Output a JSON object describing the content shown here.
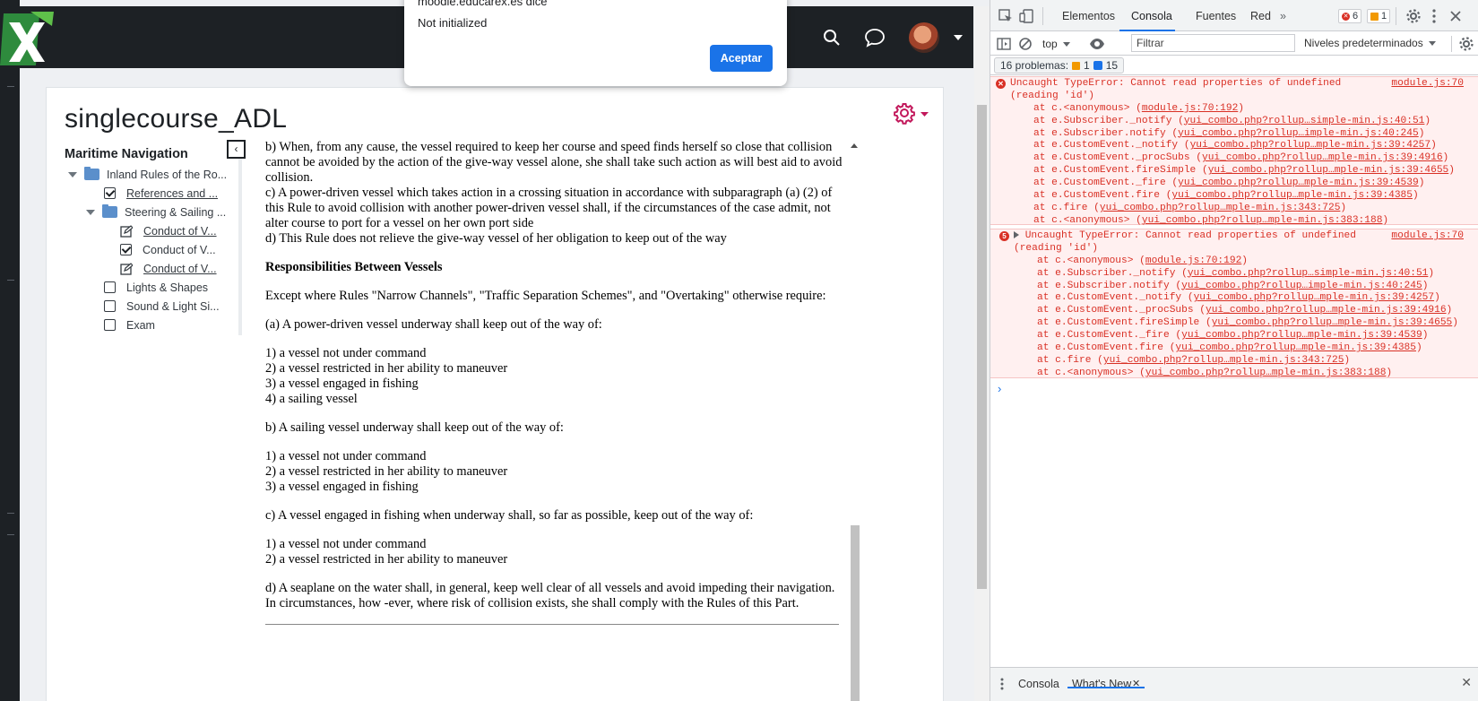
{
  "alert": {
    "title": "moodle.educarex.es dice",
    "message": "Not initialized",
    "ok_label": "Aceptar"
  },
  "course": {
    "title": "singlecourse_ADL"
  },
  "course_index": {
    "title": "Maritime Navigation",
    "items": [
      {
        "label": "Inland Rules of the Ro...",
        "kind": "section"
      },
      {
        "label": "References and ...",
        "kind": "done"
      },
      {
        "label": "Steering & Sailing ...",
        "kind": "section"
      },
      {
        "label": "Conduct of V...",
        "kind": "edit"
      },
      {
        "label": "Conduct of V...",
        "kind": "done"
      },
      {
        "label": "Conduct of V...",
        "kind": "edit"
      },
      {
        "label": "Lights & Shapes",
        "kind": "todo"
      },
      {
        "label": "Sound & Light Si...",
        "kind": "todo"
      },
      {
        "label": "Exam",
        "kind": "todo"
      }
    ]
  },
  "content": {
    "para_b": "b) When, from any cause, the vessel required to keep her course and speed finds herself so close that collision cannot be avoided by the action of the give-way vessel alone, she shall take such action as will best aid to avoid collision.",
    "para_c": "c) A power-driven vessel which takes action in a crossing situation in accordance with subparagraph (a) (2) of this Rule to avoid collision with another power-driven vessel shall, if the circumstances of the case admit, not alter course to port for a vessel on her own port side",
    "para_d": "d) This Rule does not relieve the give-way vessel of her obligation to keep out of the way",
    "heading": "Responsibilities Between Vessels",
    "intro": "Except where Rules \"Narrow Channels\", \"Traffic Separation Schemes\", and \"Overtaking\" otherwise require:",
    "sec_a": "(a) A power-driven vessel underway shall keep out of the way of:",
    "list_a": [
      "1) a vessel not under command",
      "2) a vessel restricted in her ability to maneuver",
      "3) a vessel engaged in fishing",
      "4) a sailing vessel"
    ],
    "sec_b": "b) A sailing vessel underway shall keep out of the way of:",
    "list_b": [
      "1) a vessel not under command",
      "2) a vessel restricted in her ability to maneuver",
      "3) a vessel engaged in fishing"
    ],
    "sec_c": "c) A vessel engaged in fishing when underway shall, so far as possible, keep out of the way of:",
    "list_c": [
      "1) a vessel not under command",
      "2) a vessel restricted in her ability to maneuver"
    ],
    "sec_d": "d) A seaplane on the water shall, in general, keep well clear of all vessels and avoid impeding their navigation. In circumstances, how -ever, where risk of collision exists, she shall comply with the Rules of this Part."
  },
  "devtools": {
    "tabs": [
      "Elementos",
      "Consola",
      "Fuentes",
      "Red"
    ],
    "more_tabs": "»",
    "error_count": "6",
    "warn_count": "1",
    "context": "top",
    "filter_placeholder": "Filtrar",
    "levels": "Niveles predeterminados",
    "problems_label": "16 problemas:",
    "problems_warn": "1",
    "problems_info": "15",
    "error1": {
      "message": "Uncaught TypeError: Cannot read properties of undefined",
      "message2": "(reading 'id')",
      "source": "module.js:70",
      "frames": [
        {
          "fn": "at c.<anonymous> (",
          "link": "module.js:70:192",
          "end": ")"
        },
        {
          "fn": "at e.Subscriber._notify (",
          "link": "yui_combo.php?rollup…simple-min.js:40:51",
          "end": ")"
        },
        {
          "fn": "at e.Subscriber.notify (",
          "link": "yui_combo.php?rollup…imple-min.js:40:245",
          "end": ")"
        },
        {
          "fn": "at e.CustomEvent._notify (",
          "link": "yui_combo.php?rollup…mple-min.js:39:4257",
          "end": ")"
        },
        {
          "fn": "at e.CustomEvent._procSubs (",
          "link": "yui_combo.php?rollup…mple-min.js:39:4916",
          "end": ")"
        },
        {
          "fn": "at e.CustomEvent.fireSimple (",
          "link": "yui_combo.php?rollup…mple-min.js:39:4655",
          "end": ")"
        },
        {
          "fn": "at e.CustomEvent._fire (",
          "link": "yui_combo.php?rollup…mple-min.js:39:4539",
          "end": ")"
        },
        {
          "fn": "at e.CustomEvent.fire (",
          "link": "yui_combo.php?rollup…mple-min.js:39:4385",
          "end": ")"
        },
        {
          "fn": "at c.fire (",
          "link": "yui_combo.php?rollup…mple-min.js:343:725",
          "end": ")"
        },
        {
          "fn": "at c.<anonymous> (",
          "link": "yui_combo.php?rollup…mple-min.js:383:188",
          "end": ")"
        }
      ]
    },
    "error2": {
      "count": "5",
      "message": "Uncaught TypeError: Cannot read properties of undefined",
      "message2": "(reading 'id')",
      "source": "module.js:70"
    },
    "drawer_tabs": [
      "Consola",
      "What's New"
    ],
    "colors": {
      "error": "#d93025",
      "accent": "#1a73e8",
      "warning": "#f29900"
    }
  }
}
